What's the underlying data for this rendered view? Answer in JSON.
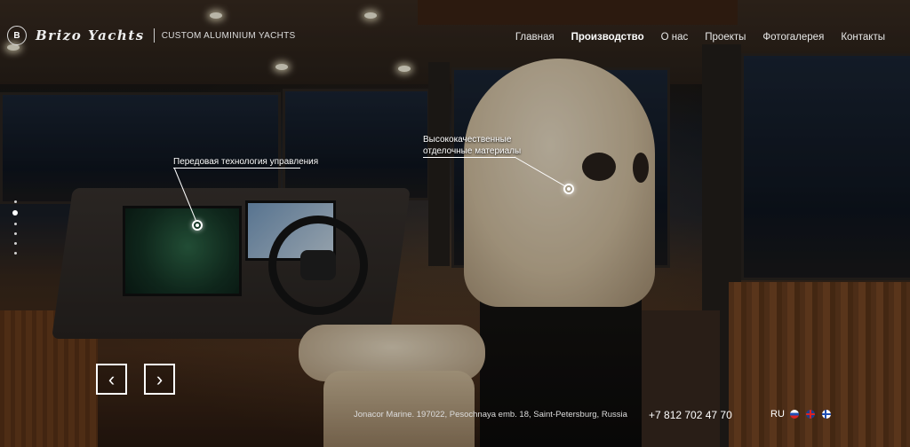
{
  "brand": {
    "name": "Brizo Yachts",
    "emblem": "B",
    "tagline": "CUSTOM ALUMINIUM YACHTS"
  },
  "nav": {
    "items": [
      {
        "label": "Главная",
        "active": false
      },
      {
        "label": "Производство",
        "active": true
      },
      {
        "label": "О нас",
        "active": false
      },
      {
        "label": "Проекты",
        "active": false
      },
      {
        "label": "Фотогалерея",
        "active": false
      },
      {
        "label": "Контакты",
        "active": false
      }
    ]
  },
  "hotspots": {
    "control": {
      "label": "Передовая технология управления"
    },
    "materials": {
      "label_line1": "Высококачественные",
      "label_line2": "отделочные материалы"
    }
  },
  "slider": {
    "prev_icon": "chevron-left-icon",
    "next_icon": "chevron-right-icon",
    "prev_glyph": "‹",
    "next_glyph": "›",
    "dots_count": 6,
    "active_dot": 1
  },
  "footer": {
    "address": "Jonacor Marine. 197022, Pesochnaya emb. 18, Saint-Petersburg, Russia",
    "phone": "+7 812 702 47 70",
    "lang_code": "RU",
    "languages": [
      "ru-flag-icon",
      "en-flag-icon",
      "fi-flag-icon"
    ]
  },
  "colors": {
    "text": "#ffffff",
    "accent": "#ffffff"
  }
}
